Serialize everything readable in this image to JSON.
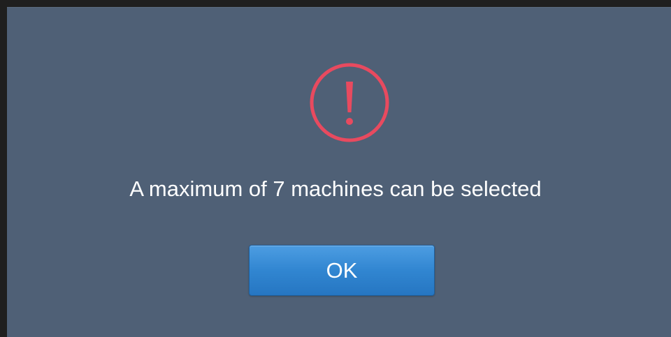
{
  "dialog": {
    "icon": "exclamation-circle-icon",
    "icon_color": "#e84a5f",
    "background_color": "#4f6076",
    "message": "A maximum of 7 machines can be selected",
    "ok_label": "OK",
    "button_color": "#3186d1"
  }
}
